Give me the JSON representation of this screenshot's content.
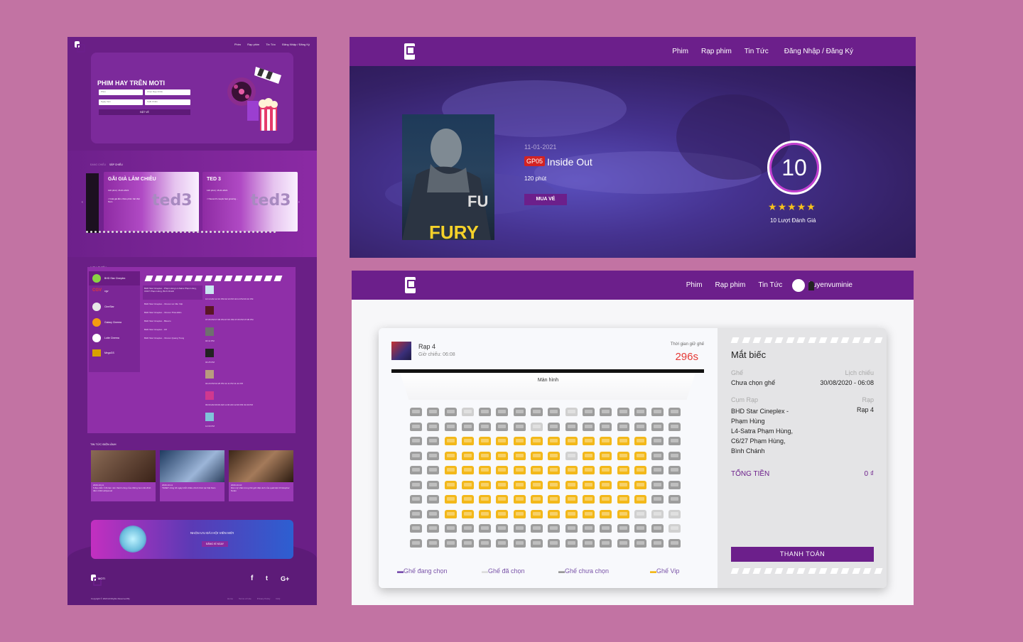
{
  "left": {
    "nav": {
      "links": [
        "Phim",
        "Rạp phim",
        "Tin Tức",
        "Đăng Nhập / Đăng Ký"
      ]
    },
    "hero": {
      "title": "PHIM HAY TRÊN MOTI",
      "field_movie": "Phim",
      "field_cinema": "Chọn Rạp Chiếu",
      "field_date": "Ngày Xem",
      "field_time": "Suất Chiếu",
      "book_btn": "ĐẶT VÉ"
    },
    "tabs": [
      "ĐANG CHIẾU",
      "SẮP CHIẾU"
    ],
    "cards": [
      {
        "title": "GÃI GIÀ LẮM CHIÊU",
        "meta": "120 phút | 15-01-2021",
        "desc": "<>Gái già lắm chiêu phim hài Việt Nam"
      },
      {
        "title": "TED 3",
        "meta": "120 phút | 15-01-2021",
        "desc": "<>Seventh couple fast growing..."
      }
    ],
    "schedule": {
      "label": "LỊCH CHIẾU",
      "chains": [
        "BHD Star Cineplex",
        "cgv",
        "CineStar",
        "Galaxy Cinema",
        "Lotte Cinema",
        "MegaGS"
      ],
      "cinemas": [
        "BHD Star Cineplex - Phạm Hùng L4-Satra Phạm Hùng, C6/27 Phạm Hùng, Bình Chánh",
        "BHD Star Cineplex - Vincom Lê Văn Việt",
        "BHD Star Cineplex - Vincom Thảo Điền",
        "BHD Star Cineplex - Bitexco",
        "BHD Star Cineplex - 3/2",
        "BHD Star Cineplex - Vincom Quang Trung"
      ],
      "times": [
        "10:10 AM   12:10 PM   02:10 PM   04:10 PM   06:10 PM",
        "07:05 PM   07:05 PM   07:05 PM   07:05 PM   07:05 PM",
        "04:11 PM",
        "04:25 PM",
        "02:20 PM   02:25 PM   11:11 PM   11:11 PM",
        "09:00 AM   09:00 AM   11:00 AM   12:00 PM   01:00 PM",
        "12:00 PM"
      ]
    },
    "news": {
      "label": "TIN TỨC ĐIỆN ẢNH",
      "items": [
        {
          "date": "2020-10-11",
          "text": "6 đạo diễn tỉ đô làm nên thành công của những bom tấn đình đám nhất Hollywood"
        },
        {
          "date": "2020-10-11",
          "text": "TENET công bố ngày khởi chiếu chính thức tại Việt Nam"
        },
        {
          "date": "2020-10-10",
          "text": "Dàn mỹ nhân trong thế giới điện ảnh của quái kiệt Christopher Nolan"
        }
      ]
    },
    "promo": {
      "text": "NHẬN ƯU ĐÃI HỘI VIÊN MỚI",
      "btn": "ĐĂNG KÍ NGAY"
    },
    "footer": {
      "brand": "MOTI",
      "copyright": "Copyright © 2020 All Rights Reserved By",
      "links": [
        "Home",
        "Terms of Use",
        "Privacy Policy",
        "FAQ"
      ]
    }
  },
  "detail": {
    "nav_links": [
      "Phim",
      "Rạp phim",
      "Tin Tức",
      "Đăng Nhập / Đăng Ký"
    ],
    "poster_text": "FURY",
    "date": "11-01-2021",
    "code": "GP05",
    "title": "Inside Out",
    "duration": "120 phút",
    "buy_btn": "MUA VÉ",
    "rating": "10",
    "stars": 5,
    "reviews": "10 Lượt Đánh Giá"
  },
  "booking": {
    "nav_links": [
      "Phim",
      "Rạp phim",
      "Tin Tức"
    ],
    "user": "huyenvuminie",
    "room": "Rạp 4",
    "showtime": "Giờ chiếu: 06:08",
    "hold_label": "Thời gian giữ ghế",
    "timer": "296s",
    "screen": "Màn hình",
    "legend": [
      "Ghế đang chọn",
      "Ghế đã chọn",
      "Ghế chưa chọn",
      "Ghế Vip"
    ],
    "seat_rows": [
      "nnnbnnnnnbnnnnnn",
      "nnnnnnnbnnnnnnnn",
      "nnvvvvvvvvvvvvnn",
      "nnvvvvvvvbvvvvnn",
      "nnvvvvvvvvvvvvnn",
      "nnvvvvvvvvvvvvnn",
      "nnvvvvvvvvvvvvnn",
      "nnvvvvvvvvvvvbbb",
      "nnnnnnnnnnnnnnnb",
      "nnnnnnnnnnnnnnnn"
    ],
    "summary": {
      "movie": "Mắt biếc",
      "seat_label": "Ghế",
      "seat_value": "Chưa chọn ghế",
      "schedule_label": "Lịch chiếu",
      "schedule_value": "30/08/2020 - 06:08",
      "cluster_label": "Cụm Rạp",
      "cluster_value": "BHD Star Cineplex - Phạm Hùng\nL4-Satra Phạm Hùng, C6/27 Phạm Hùng, Bình Chánh",
      "room_label": "Rạp",
      "room_value": "Rạp 4",
      "total_label": "TỔNG TIỀN",
      "total_value": "0 ₫",
      "pay_btn": "THANH TOÁN"
    }
  },
  "colors": {
    "brand": "#6c1f8b",
    "vip": "#f3b81a",
    "timer": "#e53935",
    "background": "#c273a3"
  }
}
